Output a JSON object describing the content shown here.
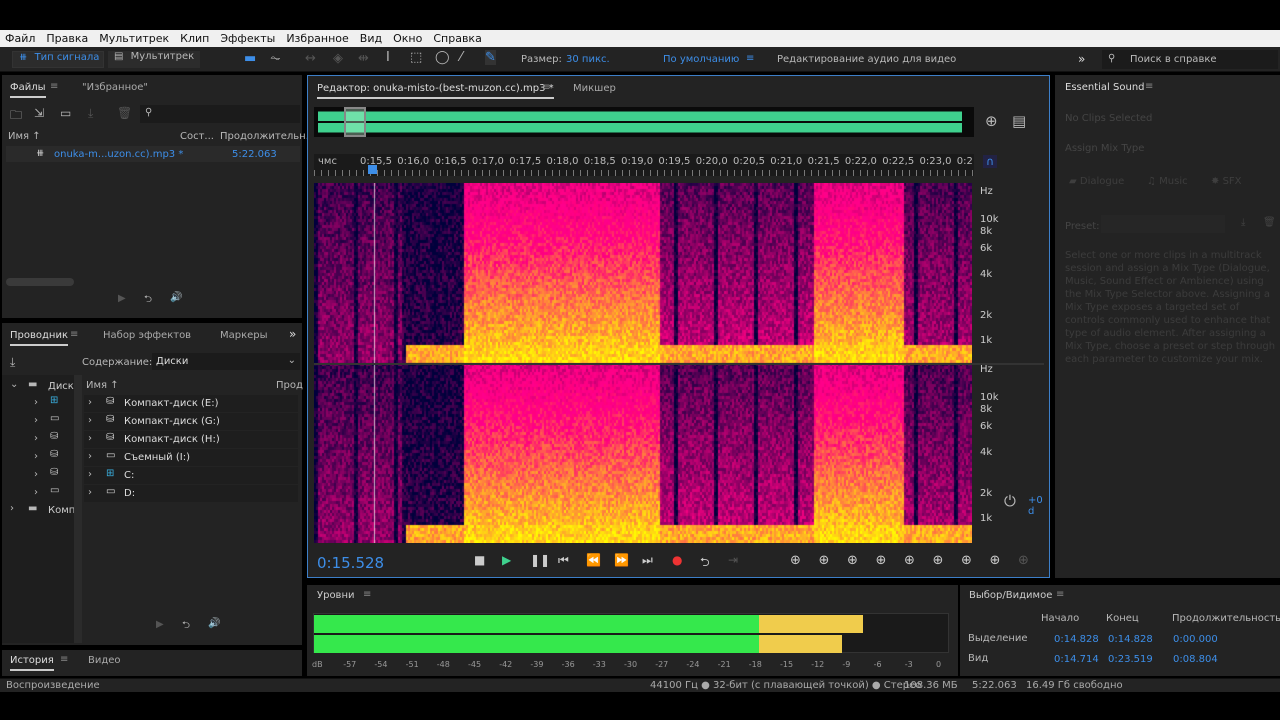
{
  "menu": [
    "Файл",
    "Правка",
    "Мультитрек",
    "Клип",
    "Эффекты",
    "Избранное",
    "Вид",
    "Окно",
    "Справка"
  ],
  "toolbar": {
    "waveform": "Тип сигнала",
    "multitrack": "Мультитрек",
    "size_label": "Размер:",
    "size_value": "30 пикс.",
    "workspace": "По умолчанию",
    "workspace2": "Редактирование аудио для видео",
    "search_placeholder": "Поиск в справке"
  },
  "files": {
    "tab1": "Файлы",
    "tab2": "\"Избранное\"",
    "col_name": "Имя",
    "col_state": "Сост...",
    "col_duration": "Продолжительн.",
    "items": [
      {
        "name": "onuka-m...uzon.cc).mp3 *",
        "duration": "5:22.063"
      }
    ]
  },
  "explorer": {
    "tab1": "Проводник",
    "tab2": "Набор эффектов",
    "tab3": "Маркеры",
    "content_label": "Содержание:",
    "content_value": "Диски",
    "tree": [
      "Диск",
      "Комп"
    ],
    "col_name": "Имя",
    "col_other": "Прод",
    "items": [
      "Компакт-диск (E:)",
      "Компакт-диск (G:)",
      "Компакт-диск (H:)",
      "Съемный (I:)",
      "C:",
      "D:"
    ]
  },
  "history": {
    "tab1": "История",
    "tab2": "Видео",
    "status": "Воспроизведение"
  },
  "editor": {
    "tab": "Редактор: onuka-misto-(best-muzon.cc).mp3 *",
    "tab2": "Микшер",
    "ruler_unit": "чмс",
    "ruler": [
      "0:15,5",
      "0:16,0",
      "0:16,5",
      "0:17,0",
      "0:17,5",
      "0:18,0",
      "0:18,5",
      "0:19,0",
      "0:19,5",
      "0:20,0",
      "0:20,5",
      "0:21,0",
      "0:21,5",
      "0:22,0",
      "0:22,5",
      "0:23,0",
      "0:2"
    ],
    "freq": [
      "Hz",
      "10k",
      "8k",
      "6k",
      "4k",
      "2k",
      "1k"
    ],
    "gain": "+0 d",
    "time": "0:15.528",
    "accent": "#3d8ee8",
    "waveform_color": "#3fd18e"
  },
  "essential": {
    "title": "Essential Sound",
    "no_clips": "No Clips Selected",
    "assign": "Assign Mix Type",
    "types": [
      "Dialogue",
      "Music",
      "SFX"
    ],
    "preset": "Preset:",
    "desc": "Select one or more clips in a multitrack session and assign a Mix Type (Dialogue, Music, Sound Effect or Ambience) using the Mix Type Selector above. Assigning a Mix Type exposes a targeted set of controls commonly used to enhance that type of audio element. After assigning a Mix Type, choose a preset or step through each parameter to customize your mix."
  },
  "levels": {
    "title": "Уровни",
    "scale": [
      "dB",
      "-57",
      "-54",
      "-51",
      "-48",
      "-45",
      "-42",
      "-39",
      "-36",
      "-33",
      "-30",
      "-27",
      "-24",
      "-21",
      "-18",
      "-15",
      "-12",
      "-9",
      "-6",
      "-3",
      "0"
    ],
    "left_db": -8,
    "right_db": -10
  },
  "selection": {
    "title": "Выбор/Видимое",
    "cols": [
      "Начало",
      "Конец",
      "Продолжительность"
    ],
    "rows": [
      {
        "label": "Выделение",
        "start": "0:14.828",
        "end": "0:14.828",
        "dur": "0:00.000"
      },
      {
        "label": "Вид",
        "start": "0:14.714",
        "end": "0:23.519",
        "dur": "0:08.804"
      }
    ]
  },
  "statusbar": {
    "format": "44100 Гц ● 32-бит (с плавающей точкой) ● Стерео",
    "size": "108.36 МБ",
    "duration": "5:22.063",
    "free": "16.49 Гб свободно"
  }
}
